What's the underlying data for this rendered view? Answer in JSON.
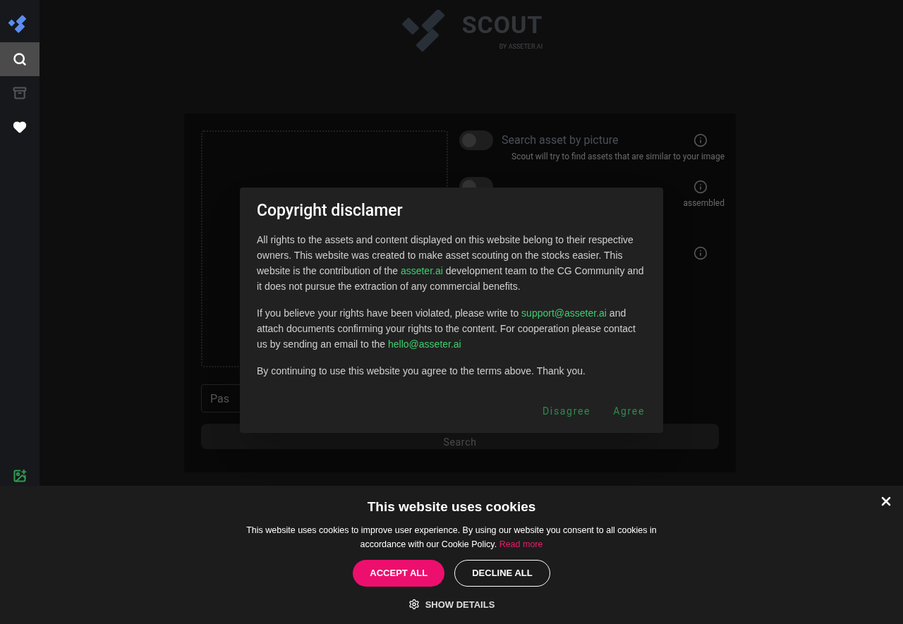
{
  "sidebar": {
    "items": [
      {
        "kind": "search",
        "selected": true
      },
      {
        "kind": "history",
        "selected": false
      },
      {
        "kind": "favorites",
        "selected": false
      }
    ]
  },
  "logo": {
    "name": "SCOUT",
    "byline": "BY ASSETER.AI"
  },
  "search_panel": {
    "options": [
      {
        "title": "Search asset by picture",
        "hint": "Scout will try to find assets that are similar to your image",
        "on": false
      },
      {
        "hint": "assembled",
        "on": false
      }
    ],
    "url_field": {
      "placeholder": "Pas"
    },
    "search_button": "Search"
  },
  "dialog": {
    "title": "Copyright disclamer",
    "paragraphs": [
      [
        {
          "kind": "text",
          "text": "All rights to the assets and content displayed on this website belong to their respective owners. This website was created to make asset scouting on the stocks easier. This website is the contribution of the "
        },
        {
          "kind": "link",
          "text": "asseter.ai"
        },
        {
          "kind": "text",
          "text": " development team to the CG Community and it does not pursue the extraction of any commercial benefits."
        }
      ],
      [
        {
          "kind": "text",
          "text": "If you believe your rights have been violated, please write to "
        },
        {
          "kind": "link",
          "text": "support@asseter.ai"
        },
        {
          "kind": "text",
          "text": " and attach documents confirming your rights to the content. For cooperation please contact us by sending an email to the "
        },
        {
          "kind": "link",
          "text": "hello@asseter.ai"
        }
      ],
      [
        {
          "kind": "text",
          "text": "By continuing to use this website you agree to the terms above. Thank you."
        }
      ]
    ],
    "buttons": [
      "Disagree",
      "Agree"
    ]
  },
  "cookie_banner": {
    "title": "This website uses cookies",
    "text": "This website uses cookies to improve user experience. By using our website you consent to all cookies in accordance with our Cookie Policy.",
    "link": "Read more",
    "accept": "ACCEPT ALL",
    "decline": "DECLINE ALL",
    "details": "SHOW DETAILS"
  }
}
